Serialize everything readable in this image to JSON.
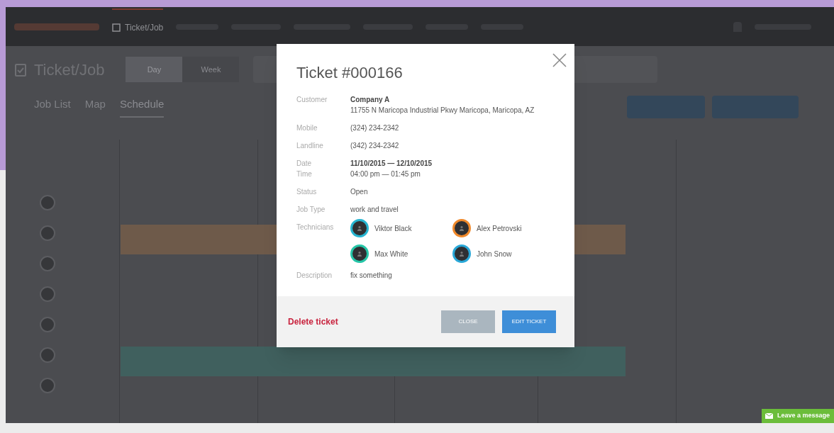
{
  "nav": {
    "items": [
      {
        "label": "Ticket/Job",
        "selected": true
      }
    ]
  },
  "page": {
    "title": "Ticket/Job",
    "view_toggle": [
      {
        "label": "Day",
        "selected": true
      },
      {
        "label": "Week",
        "selected": false
      }
    ],
    "tabs": [
      {
        "label": "Job List",
        "selected": false
      },
      {
        "label": "Map",
        "selected": false
      },
      {
        "label": "Schedule",
        "selected": true
      }
    ]
  },
  "schedule": {
    "events": [
      {
        "color": "#6e5a4a"
      },
      {
        "color": "#40605e"
      }
    ]
  },
  "modal": {
    "title": "Ticket #000166",
    "rows": [
      {
        "labels": [
          "Customer"
        ],
        "values": [
          {
            "text": "Company A",
            "bold": true
          },
          {
            "text": "11755 N Maricopa Industrial Pkwy Maricopa, Maricopa, AZ",
            "bold": false
          }
        ]
      },
      {
        "labels": [
          "Mobile"
        ],
        "values": [
          {
            "text": "(324) 234-2342",
            "bold": false
          }
        ]
      },
      {
        "labels": [
          "Landline"
        ],
        "values": [
          {
            "text": "(342) 234-2342",
            "bold": false
          }
        ]
      },
      {
        "labels": [
          "Date",
          "Time"
        ],
        "values": [
          {
            "text": "11/10/2015 — 12/10/2015",
            "bold": true
          },
          {
            "text": "04:00 pm — 01:45 pm",
            "bold": false
          }
        ]
      },
      {
        "labels": [
          "Status"
        ],
        "values": [
          {
            "text": "Open",
            "bold": false
          }
        ]
      },
      {
        "labels": [
          "Job Type"
        ],
        "values": [
          {
            "text": "work and travel",
            "bold": false
          }
        ]
      },
      {
        "labels": [
          "Technicians"
        ],
        "technicians": [
          {
            "name": "Viktor Black",
            "color": "#27b5d1"
          },
          {
            "name": "Alex Petrovski",
            "color": "#f0892b"
          },
          {
            "name": "Max White",
            "color": "#26c6a8"
          },
          {
            "name": "John Snow",
            "color": "#29a8d8"
          }
        ]
      },
      {
        "labels": [
          "Description"
        ],
        "values": [
          {
            "text": "fix something",
            "bold": false
          }
        ]
      }
    ],
    "delete_link": "Delete ticket",
    "buttons": [
      {
        "label": "CLOSE",
        "kind": "secondary"
      },
      {
        "label": "EDIT TICKET",
        "kind": "primary"
      }
    ]
  },
  "chat_widget": {
    "label": "Leave a message"
  }
}
